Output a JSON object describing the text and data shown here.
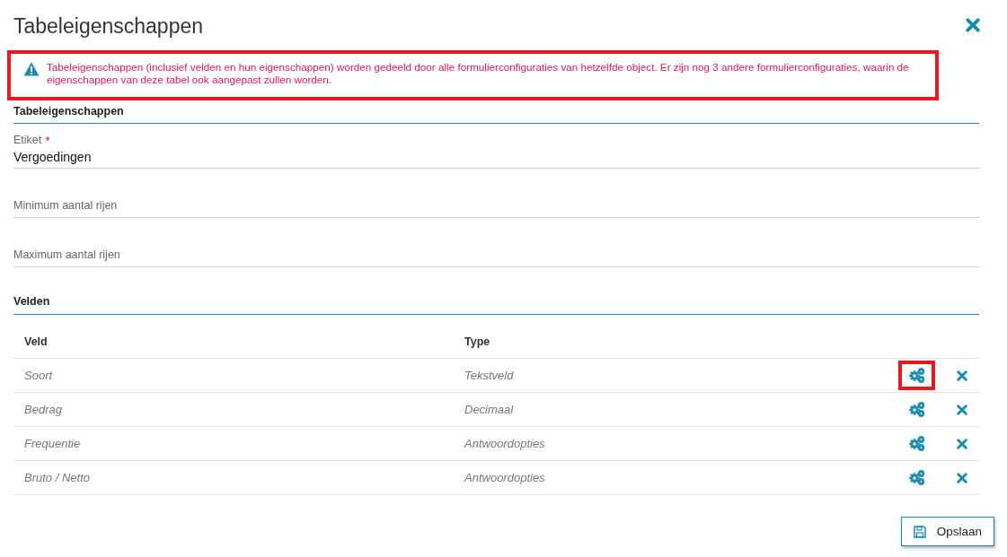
{
  "dialog": {
    "title": "Tabeleigenschappen"
  },
  "warning": {
    "text": "Tabeleigenschappen (inclusief velden en hun eigenschappen) worden gedeeld door alle formulierconfiguraties van hetzelfde object. Er zijn nog 3 andere formulierconfiguraties, waarin de eigenschappen van deze tabel ook aangepast zullen worden.",
    "highlighted": true
  },
  "section": {
    "title": "Tabeleigenschappen"
  },
  "fields": [
    {
      "label": "Etiket",
      "required_mark": "*",
      "value": "Vergoedingen"
    },
    {
      "label": "Minimum aantal rijen"
    },
    {
      "label": "Maximum aantal rijen"
    }
  ],
  "velden": {
    "title": "Velden",
    "columns": [
      "Veld",
      "Type"
    ],
    "rows": [
      {
        "veld": "Soort",
        "type": "Tekstveld",
        "highlighted": true
      },
      {
        "veld": "Bedrag",
        "type": "Decimaal",
        "highlighted": false
      },
      {
        "veld": "Frequentie",
        "type": "Antwoordopties",
        "highlighted": false
      },
      {
        "veld": "Bruto / Netto",
        "type": "Antwoordopties",
        "highlighted": false
      }
    ]
  },
  "save_button": {
    "label": "Opslaan"
  }
}
